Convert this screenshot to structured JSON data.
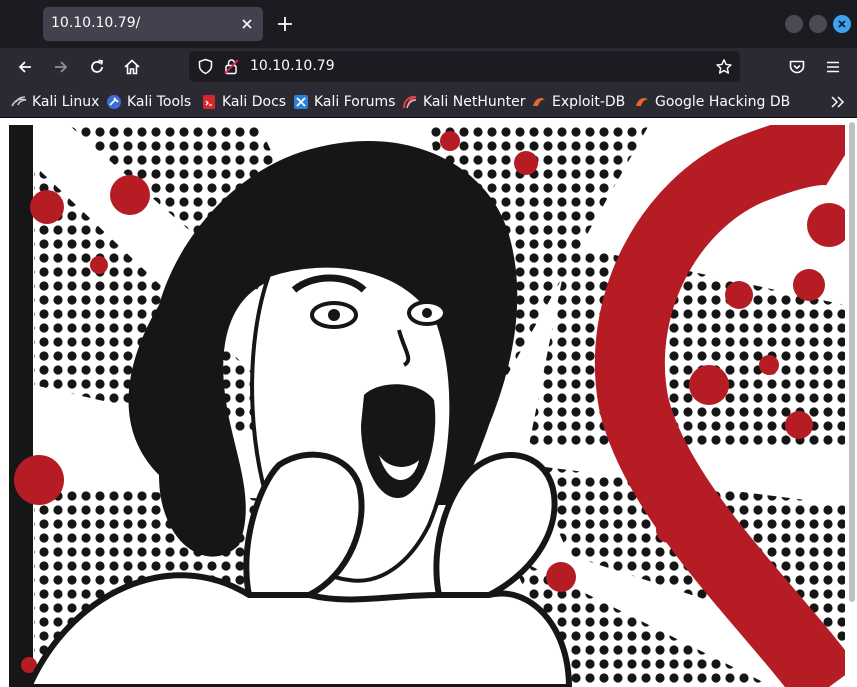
{
  "browser": {
    "tab": {
      "title": "10.10.10.79/"
    },
    "url": "10.10.10.79",
    "accent_color": "#3da2f0"
  },
  "navigation": {
    "icons": [
      "back-icon",
      "forward-icon",
      "reload-icon",
      "home-icon"
    ]
  },
  "bookmarks": [
    {
      "label": "Kali Linux",
      "icon": "kali-dragon-icon"
    },
    {
      "label": "Kali Tools",
      "icon": "kali-tools-icon"
    },
    {
      "label": "Kali Docs",
      "icon": "kali-docs-icon"
    },
    {
      "label": "Kali Forums",
      "icon": "kali-forums-icon"
    },
    {
      "label": "Kali NetHunter",
      "icon": "kali-nethunter-icon"
    },
    {
      "label": "Exploit-DB",
      "icon": "exploit-db-icon"
    },
    {
      "label": "Google Hacking DB",
      "icon": "exploit-db-icon"
    }
  ],
  "page": {
    "image_description": "pop-art-screaming-woman-heartbleed-logo",
    "colors": {
      "blood_red": "#b51c24",
      "ink": "#161616",
      "paper": "#ffffff"
    }
  }
}
